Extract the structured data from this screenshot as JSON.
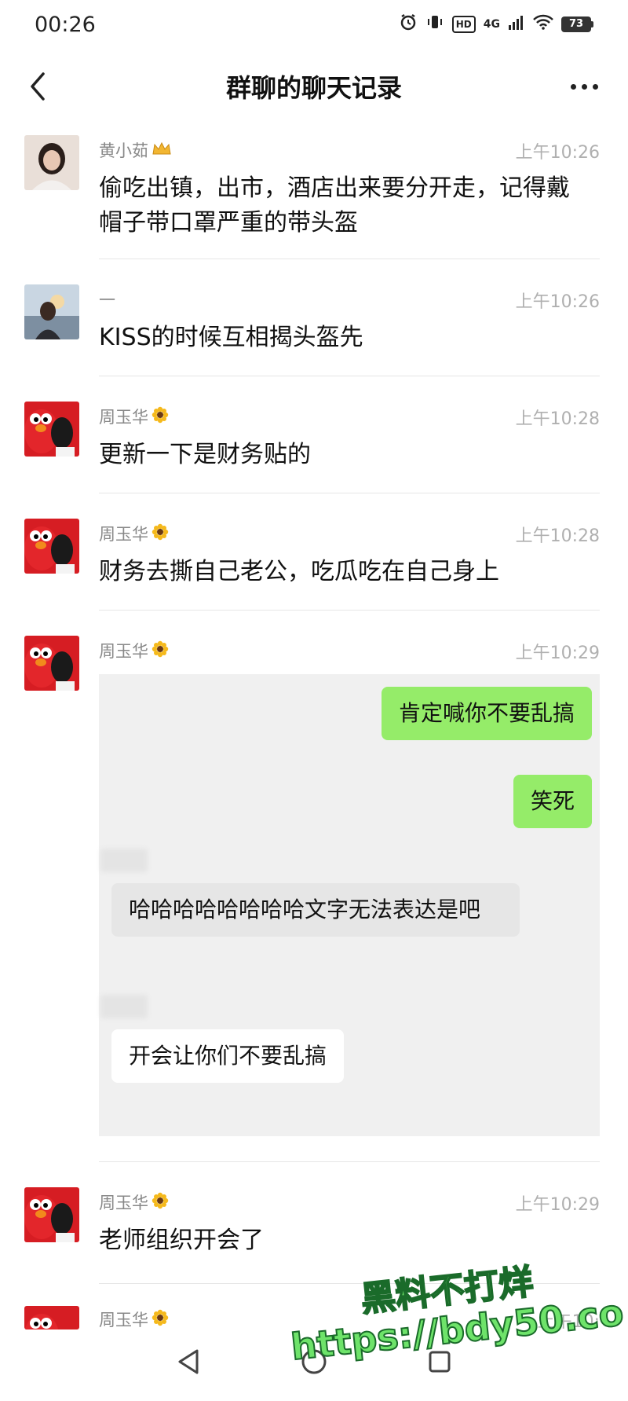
{
  "status_bar": {
    "time": "00:26",
    "hd": "HD",
    "network": "4G",
    "battery": "73"
  },
  "nav": {
    "title": "群聊的聊天记录"
  },
  "messages": [
    {
      "sender": "黄小茹",
      "badge_icon": "crown-icon",
      "time": "上午10:26",
      "text": "偷吃出镇，出市，酒店出来要分开走，记得戴帽子带口罩严重的带头盔"
    },
    {
      "sender": "一",
      "time": "上午10:26",
      "text": "KISS的时候互相揭头盔先"
    },
    {
      "sender": "周玉华",
      "badge_icon": "sunflower-icon",
      "time": "上午10:28",
      "text": "更新一下是财务贴的"
    },
    {
      "sender": "周玉华",
      "badge_icon": "sunflower-icon",
      "time": "上午10:28",
      "text": "财务去撕自己老公，吃瓜吃在自己身上"
    },
    {
      "sender": "周玉华",
      "badge_icon": "sunflower-icon",
      "time": "上午10:29",
      "text": ""
    },
    {
      "sender": "周玉华",
      "badge_icon": "sunflower-icon",
      "time": "上午10:29",
      "text": "老师组织开会了"
    },
    {
      "sender": "周玉华",
      "badge_icon": "sunflower-icon",
      "time": "上午10:",
      "text": ""
    }
  ],
  "embedded_chat": {
    "bubbles": [
      {
        "text": "肯定喊你不要乱搞",
        "side": "right",
        "color": "#95ec69"
      },
      {
        "text": "笑死",
        "side": "right",
        "color": "#95ec69"
      },
      {
        "text": "哈哈哈哈哈哈哈哈文字无法表达是吧",
        "side": "left",
        "color": "#e6e6e6"
      },
      {
        "text": "开会让你们不要乱搞",
        "side": "left",
        "color": "#ffffff"
      }
    ]
  },
  "watermark": {
    "line1": "黑料不打烊",
    "line2": "https://bdy50.co"
  },
  "colors": {
    "bubble_green": "#95ec69",
    "timestamp_gray": "#b0b0b0",
    "sender_gray": "#888888",
    "watermark_green": "#6ee36a"
  }
}
